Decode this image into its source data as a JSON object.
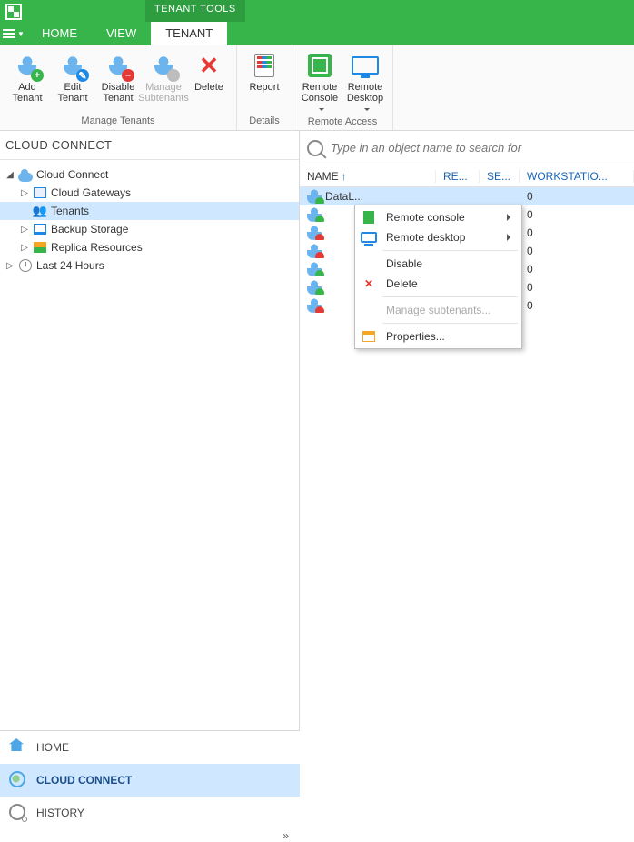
{
  "titlebar": {
    "tools_tab": "TENANT TOOLS"
  },
  "menu": {
    "items": [
      "HOME",
      "VIEW",
      "TENANT"
    ],
    "active": 2
  },
  "ribbon": {
    "groups": [
      {
        "label": "Manage Tenants",
        "buttons": [
          {
            "id": "add-tenant",
            "line1": "Add",
            "line2": "Tenant",
            "badge": "+",
            "bclass": "b-green"
          },
          {
            "id": "edit-tenant",
            "line1": "Edit",
            "line2": "Tenant",
            "badge": "✎",
            "bclass": "b-blue"
          },
          {
            "id": "disable-tenant",
            "line1": "Disable",
            "line2": "Tenant",
            "badge": "–",
            "bclass": "b-red"
          },
          {
            "id": "manage-subtenants",
            "line1": "Manage",
            "line2": "Subtenants",
            "disabled": true,
            "badge": "",
            "bclass": "b-grey"
          },
          {
            "id": "delete",
            "line1": "Delete",
            "line2": "",
            "icon": "x"
          }
        ]
      },
      {
        "label": "Details",
        "buttons": [
          {
            "id": "report",
            "line1": "Report",
            "line2": "",
            "icon": "report"
          }
        ]
      },
      {
        "label": "Remote Access",
        "buttons": [
          {
            "id": "remote-console",
            "line1": "Remote",
            "line2": "Console",
            "icon": "rc",
            "dropdown": true
          },
          {
            "id": "remote-desktop",
            "line1": "Remote",
            "line2": "Desktop",
            "icon": "rd",
            "dropdown": true
          }
        ]
      }
    ]
  },
  "left_panel_title": "CLOUD CONNECT",
  "tree": [
    {
      "label": "Cloud Connect",
      "icon": "cloud",
      "expanded": true,
      "level": 0,
      "children": [
        {
          "label": "Cloud Gateways",
          "icon": "gw",
          "level": 1,
          "expander": "▷"
        },
        {
          "label": "Tenants",
          "icon": "people",
          "level": 1,
          "selected": true
        },
        {
          "label": "Backup Storage",
          "icon": "store",
          "level": 1,
          "expander": "▷"
        },
        {
          "label": "Replica Resources",
          "icon": "rep",
          "level": 1,
          "expander": "▷"
        }
      ]
    },
    {
      "label": "Last 24 Hours",
      "icon": "clock",
      "level": 0,
      "expander": "▷"
    }
  ],
  "nav": [
    {
      "label": "HOME",
      "icon": "home"
    },
    {
      "label": "CLOUD CONNECT",
      "icon": "globe",
      "active": true
    },
    {
      "label": "HISTORY",
      "icon": "hist"
    }
  ],
  "search_placeholder": "Type in an object name to search for",
  "grid": {
    "columns": [
      {
        "id": "name",
        "label": "NAME",
        "sort": "asc"
      },
      {
        "id": "re",
        "label": "RE..."
      },
      {
        "id": "se",
        "label": "SE..."
      },
      {
        "id": "ws",
        "label": "WORKSTATIO..."
      }
    ],
    "rows": [
      {
        "name": "DataL...",
        "ws": "0",
        "status": "ok",
        "selected": true
      },
      {
        "name": "",
        "ws": "0",
        "status": "ok"
      },
      {
        "name": "",
        "ws": "0",
        "status": "disabled"
      },
      {
        "name": "",
        "ws": "0",
        "status": "disabled"
      },
      {
        "name": "",
        "ws": "0",
        "status": "ok"
      },
      {
        "name": "",
        "ws": "0",
        "status": "ok"
      },
      {
        "name": "",
        "ws": "0",
        "status": "disabled"
      }
    ]
  },
  "context_menu": [
    {
      "label": "Remote console",
      "icon": "rc",
      "submenu": true
    },
    {
      "label": "Remote desktop",
      "icon": "rd",
      "submenu": true
    },
    {
      "sep": true
    },
    {
      "label": "Disable"
    },
    {
      "label": "Delete",
      "icon": "x"
    },
    {
      "sep": true
    },
    {
      "label": "Manage subtenants...",
      "disabled": true
    },
    {
      "sep": true
    },
    {
      "label": "Properties...",
      "icon": "props"
    }
  ]
}
